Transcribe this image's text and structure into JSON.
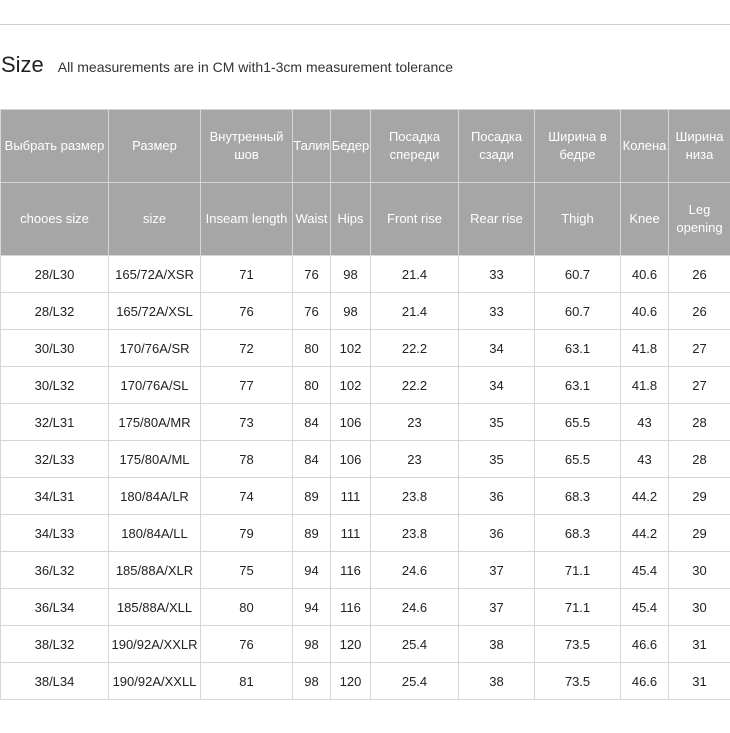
{
  "heading": {
    "title": "Size",
    "subtitle": "All measurements are in CM with1-3cm measurement tolerance"
  },
  "table": {
    "header_ru": [
      "Выбрать размер",
      "Размер",
      "Внутренный шов",
      "Талия",
      "Бедер",
      "Посадка спереди",
      "Посадка сзади",
      "Ширина в бедре",
      "Колена",
      "Ширина низа"
    ],
    "header_en": [
      "chooes size",
      "size",
      "Inseam length",
      "Waist",
      "Hips",
      "Front rise",
      "Rear rise",
      "Thigh",
      "Knee",
      "Leg opening"
    ],
    "rows": [
      [
        "28/L30",
        "165/72A/XSR",
        "71",
        "76",
        "98",
        "21.4",
        "33",
        "60.7",
        "40.6",
        "26"
      ],
      [
        "28/L32",
        "165/72A/XSL",
        "76",
        "76",
        "98",
        "21.4",
        "33",
        "60.7",
        "40.6",
        "26"
      ],
      [
        "30/L30",
        "170/76A/SR",
        "72",
        "80",
        "102",
        "22.2",
        "34",
        "63.1",
        "41.8",
        "27"
      ],
      [
        "30/L32",
        "170/76A/SL",
        "77",
        "80",
        "102",
        "22.2",
        "34",
        "63.1",
        "41.8",
        "27"
      ],
      [
        "32/L31",
        "175/80A/MR",
        "73",
        "84",
        "106",
        "23",
        "35",
        "65.5",
        "43",
        "28"
      ],
      [
        "32/L33",
        "175/80A/ML",
        "78",
        "84",
        "106",
        "23",
        "35",
        "65.5",
        "43",
        "28"
      ],
      [
        "34/L31",
        "180/84A/LR",
        "74",
        "89",
        "111",
        "23.8",
        "36",
        "68.3",
        "44.2",
        "29"
      ],
      [
        "34/L33",
        "180/84A/LL",
        "79",
        "89",
        "111",
        "23.8",
        "36",
        "68.3",
        "44.2",
        "29"
      ],
      [
        "36/L32",
        "185/88A/XLR",
        "75",
        "94",
        "116",
        "24.6",
        "37",
        "71.1",
        "45.4",
        "30"
      ],
      [
        "36/L34",
        "185/88A/XLL",
        "80",
        "94",
        "116",
        "24.6",
        "37",
        "71.1",
        "45.4",
        "30"
      ],
      [
        "38/L32",
        "190/92A/XXLR",
        "76",
        "98",
        "120",
        "25.4",
        "38",
        "73.5",
        "46.6",
        "31"
      ],
      [
        "38/L34",
        "190/92A/XXLL",
        "81",
        "98",
        "120",
        "25.4",
        "38",
        "73.5",
        "46.6",
        "31"
      ]
    ]
  }
}
